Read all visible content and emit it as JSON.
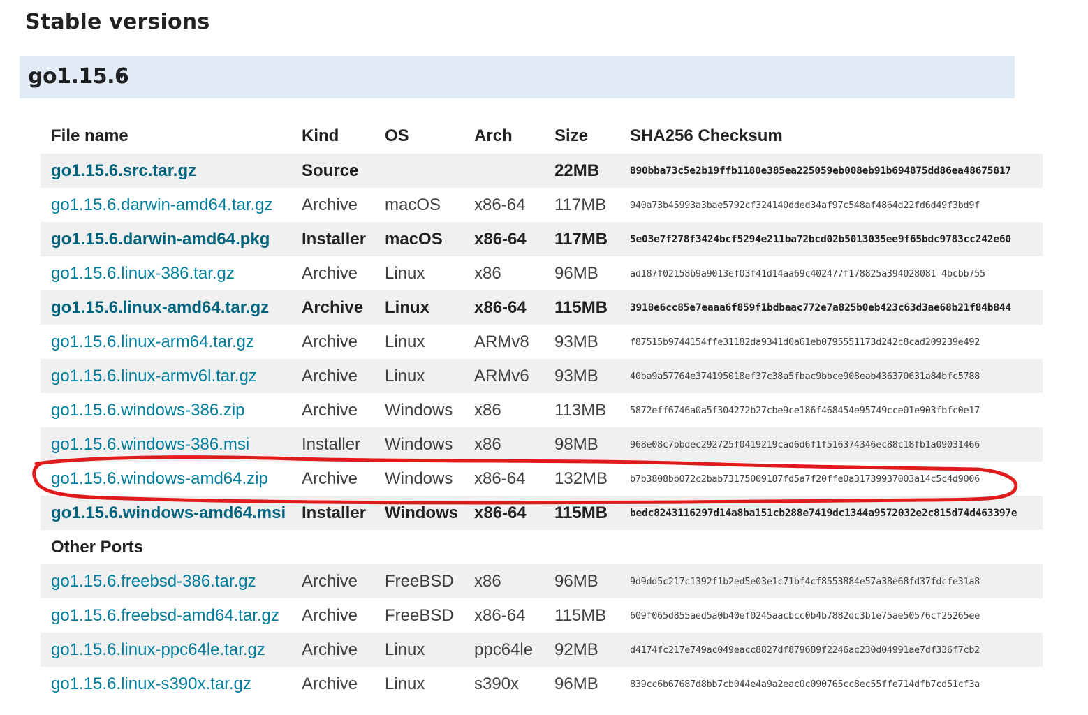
{
  "section_title": "Stable versions",
  "version": {
    "label": "go1.15.6",
    "caret": "▼"
  },
  "table": {
    "headers": {
      "file": "File name",
      "kind": "Kind",
      "os": "OS",
      "arch": "Arch",
      "size": "Size",
      "checksum": "SHA256 Checksum"
    },
    "rows": [
      {
        "file": "go1.15.6.src.tar.gz",
        "kind": "Source",
        "os": "",
        "arch": "",
        "size": "22MB",
        "checksum": "890bba73c5e2b19ffb1180e385ea225059eb008eb91b694875dd86ea48675817",
        "featured": true
      },
      {
        "file": "go1.15.6.darwin-amd64.tar.gz",
        "kind": "Archive",
        "os": "macOS",
        "arch": "x86-64",
        "size": "117MB",
        "checksum": "940a73b45993a3bae5792cf324140dded34af97c548af4864d22fd6d49f3bd9f",
        "featured": false
      },
      {
        "file": "go1.15.6.darwin-amd64.pkg",
        "kind": "Installer",
        "os": "macOS",
        "arch": "x86-64",
        "size": "117MB",
        "checksum": "5e03e7f278f3424bcf5294e211ba72bcd02b5013035ee9f65bdc9783cc242e60",
        "featured": true
      },
      {
        "file": "go1.15.6.linux-386.tar.gz",
        "kind": "Archive",
        "os": "Linux",
        "arch": "x86",
        "size": "96MB",
        "checksum": "ad187f02158b9a9013ef03f41d14aa69c402477f178825a394028081 4bcbb755",
        "featured": false
      },
      {
        "file": "go1.15.6.linux-amd64.tar.gz",
        "kind": "Archive",
        "os": "Linux",
        "arch": "x86-64",
        "size": "115MB",
        "checksum": "3918e6cc85e7eaaa6f859f1bdbaac772e7a825b0eb423c63d3ae68b21f84b844",
        "featured": true
      },
      {
        "file": "go1.15.6.linux-arm64.tar.gz",
        "kind": "Archive",
        "os": "Linux",
        "arch": "ARMv8",
        "size": "93MB",
        "checksum": "f87515b9744154ffe31182da9341d0a61eb0795551173d242c8cad209239e492",
        "featured": false
      },
      {
        "file": "go1.15.6.linux-armv6l.tar.gz",
        "kind": "Archive",
        "os": "Linux",
        "arch": "ARMv6",
        "size": "93MB",
        "checksum": "40ba9a57764e374195018ef37c38a5fbac9bbce908eab436370631a84bfc5788",
        "featured": false
      },
      {
        "file": "go1.15.6.windows-386.zip",
        "kind": "Archive",
        "os": "Windows",
        "arch": "x86",
        "size": "113MB",
        "checksum": "5872eff6746a0a5f304272b27cbe9ce186f468454e95749cce01e903fbfc0e17",
        "featured": false
      },
      {
        "file": "go1.15.6.windows-386.msi",
        "kind": "Installer",
        "os": "Windows",
        "arch": "x86",
        "size": "98MB",
        "checksum": "968e08c7bbdec292725f0419219cad6d6f1f516374346ec88c18fb1a09031466",
        "featured": false
      },
      {
        "file": "go1.15.6.windows-amd64.zip",
        "kind": "Archive",
        "os": "Windows",
        "arch": "x86-64",
        "size": "132MB",
        "checksum": "b7b3808bb072c2bab73175009187fd5a7f20ffe0a31739937003a14c5c4d9006",
        "featured": false
      },
      {
        "file": "go1.15.6.windows-amd64.msi",
        "kind": "Installer",
        "os": "Windows",
        "arch": "x86-64",
        "size": "115MB",
        "checksum": "bedc8243116297d14a8ba151cb288e7419dc1344a9572032e2c815d74d463397e",
        "featured": true
      }
    ],
    "other_ports_label": "Other Ports",
    "other_rows": [
      {
        "file": "go1.15.6.freebsd-386.tar.gz",
        "kind": "Archive",
        "os": "FreeBSD",
        "arch": "x86",
        "size": "96MB",
        "checksum": "9d9dd5c217c1392f1b2ed5e03e1c71bf4cf8553884e57a38e68fd37fdcfe31a8",
        "featured": false
      },
      {
        "file": "go1.15.6.freebsd-amd64.tar.gz",
        "kind": "Archive",
        "os": "FreeBSD",
        "arch": "x86-64",
        "size": "115MB",
        "checksum": "609f065d855aed5a0b40ef0245aacbcc0b4b7882dc3b1e75ae50576cf25265ee",
        "featured": false
      },
      {
        "file": "go1.15.6.linux-ppc64le.tar.gz",
        "kind": "Archive",
        "os": "Linux",
        "arch": "ppc64le",
        "size": "92MB",
        "checksum": "d4174fc217e749ac049eacc8827df879689f2246ac230d04991ae7df336f7cb2",
        "featured": false
      },
      {
        "file": "go1.15.6.linux-s390x.tar.gz",
        "kind": "Archive",
        "os": "Linux",
        "arch": "s390x",
        "size": "96MB",
        "checksum": "839cc6b67687d8bb7cb044e4a9a2eac0c090765cc8ec55ffe714dfb7cd51cf3a",
        "featured": false
      }
    ]
  },
  "annotation": {
    "color": "#e01b1b",
    "target": "go1.15.6.windows-amd64.zip"
  }
}
